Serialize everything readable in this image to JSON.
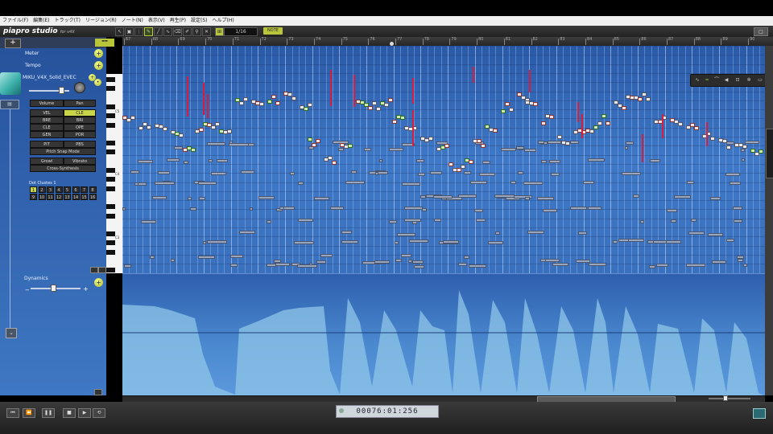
{
  "menu": [
    "ファイル(F)",
    "編集(E)",
    "トラック(T)",
    "リージョン(R)",
    "ノート(N)",
    "表示(V)",
    "再生(P)",
    "設定(S)",
    "ヘルプ(H)"
  ],
  "brand": {
    "name": "piapro studio",
    "suffix": "for v4X"
  },
  "toolbar": {
    "quantize": "1/16",
    "mode_button": "NOTE",
    "window_button": "□"
  },
  "left": {
    "add_label": "+",
    "meter_label": "Meter",
    "tempo_label": "Tempo",
    "singer": "MIKU_V4X_Solid_EVEC",
    "dynamics_label": "Dynamics",
    "param_buttons": [
      [
        "Volume",
        "Pan"
      ],
      [
        "VEL",
        "CLE"
      ],
      [
        "BRE",
        "BRI"
      ],
      [
        "CLE",
        "OPE"
      ],
      [
        "GEN",
        "POR"
      ],
      [
        "PIT",
        "PBS"
      ]
    ],
    "wide_buttons": [
      "Pitch Snap Mode"
    ],
    "pair_buttons": [
      "Growl",
      "Vibrato"
    ],
    "cross_button": "Cross-Synthesis",
    "group_label": "Dot Clustes 1",
    "groups": [
      "1",
      "2",
      "3",
      "4",
      "5",
      "6",
      "7",
      "8",
      "9",
      "10",
      "11",
      "12",
      "13",
      "14",
      "15",
      "16"
    ],
    "octaves": [
      "C5",
      "C4",
      "C3"
    ]
  },
  "ruler_numbers": [
    "67",
    "68",
    "69",
    "70",
    "71",
    "72",
    "73",
    "74",
    "75",
    "76",
    "77",
    "78",
    "79",
    "80",
    "81",
    "82",
    "83",
    "84",
    "85",
    "86",
    "87",
    "88",
    "89",
    "90"
  ],
  "time_display": "00076:01:256",
  "transport": {
    "rew": "⏮",
    "back": "⏪",
    "play": "▶",
    "pause": "❚❚",
    "stop": "■",
    "loop": "⟲"
  },
  "colors": {
    "grid_top": "#2a5aa8",
    "pitch": "#d81e3e",
    "accent": "#b9c63a",
    "dynamics": "#8fc6e8"
  }
}
